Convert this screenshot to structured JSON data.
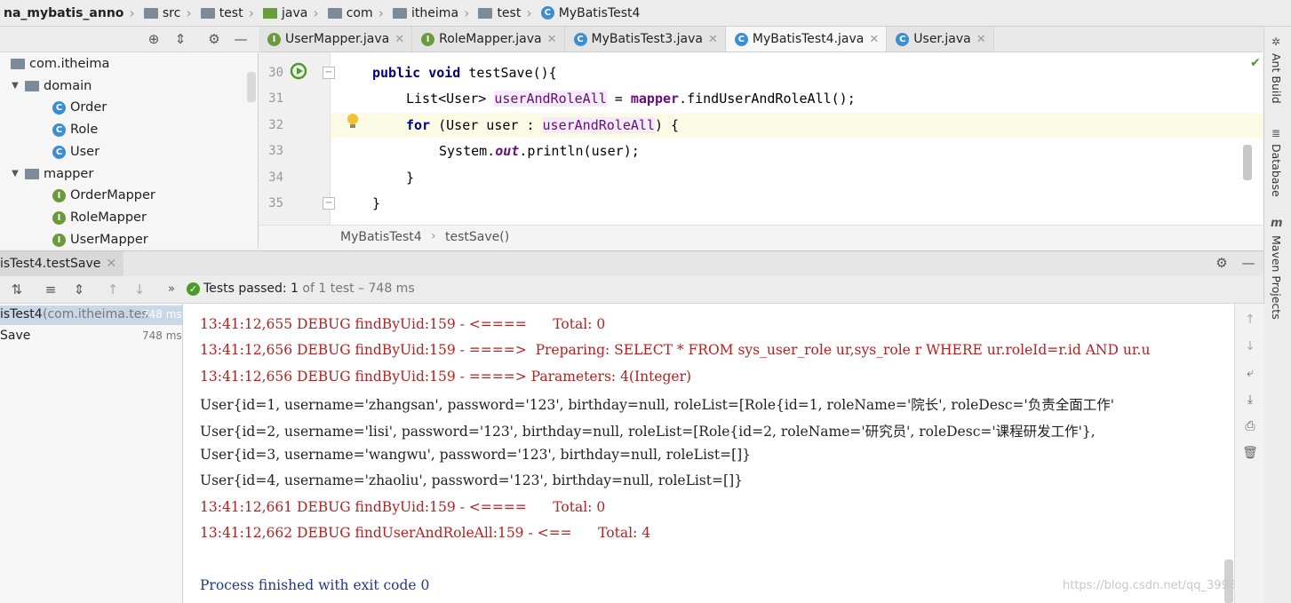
{
  "breadcrumb": [
    "na_mybatis_anno",
    "src",
    "test",
    "java",
    "com",
    "itheima",
    "test",
    "MyBatisTest4"
  ],
  "project_tree": [
    {
      "label": "com.itheima",
      "icon": "package-icon",
      "indent": 0
    },
    {
      "label": "domain",
      "icon": "package-icon",
      "indent": 1,
      "expanded": true
    },
    {
      "label": "Order",
      "icon": "class-icon",
      "indent": 2
    },
    {
      "label": "Role",
      "icon": "class-icon",
      "indent": 2
    },
    {
      "label": "User",
      "icon": "class-icon",
      "indent": 2
    },
    {
      "label": "mapper",
      "icon": "package-icon",
      "indent": 1,
      "expanded": true
    },
    {
      "label": "OrderMapper",
      "icon": "interface-icon",
      "indent": 2
    },
    {
      "label": "RoleMapper",
      "icon": "interface-icon",
      "indent": 2
    },
    {
      "label": "UserMapper",
      "icon": "interface-icon",
      "indent": 2
    }
  ],
  "tabs": [
    {
      "label": "UserMapper.java",
      "icon": "interface-icon",
      "active": false
    },
    {
      "label": "RoleMapper.java",
      "icon": "interface-icon",
      "active": false
    },
    {
      "label": "MyBatisTest3.java",
      "icon": "class-icon",
      "active": false
    },
    {
      "label": "MyBatisTest4.java",
      "icon": "class-icon",
      "active": true
    },
    {
      "label": "User.java",
      "icon": "class-icon",
      "active": false
    }
  ],
  "code": {
    "line_numbers": [
      "30",
      "31",
      "32",
      "33",
      "34",
      "35"
    ],
    "l30_kw": "public void",
    "l30_rest": " testSave(){",
    "l31_a": "List<User> ",
    "l31_var": "userAndRoleAll",
    "l31_b": " = ",
    "l31_mapper": "mapper",
    "l31_c": ".findUserAndRoleAll();",
    "l32_kw": "for",
    "l32_a": " (User user : ",
    "l32_var": "userAndRoleAll",
    "l32_b": ") {",
    "l33_a": "System.",
    "l33_out": "out",
    "l33_b": ".println(user);",
    "l34": "}",
    "l35": "}"
  },
  "editor_breadcrumb": [
    "MyBatisTest4",
    "testSave()"
  ],
  "run": {
    "tab_label": "isTest4.testSave",
    "status_label": "Tests passed:",
    "passed": "1",
    "of_text": "of 1 test – 748 ms",
    "tests": [
      {
        "name": "isTest4",
        "detail": "(com.itheima.tes",
        "time": "748 ms"
      },
      {
        "name": "Save",
        "detail": "",
        "time": "748 ms"
      }
    ]
  },
  "console": [
    {
      "kind": "dbg",
      "text": "13:41:12,655 DEBUG findByUid:159 - <====      Total: 0"
    },
    {
      "kind": "dbg",
      "text": "13:41:12,656 DEBUG findByUid:159 - ====>  Preparing: SELECT * FROM sys_user_role ur,sys_role r WHERE ur.roleId=r.id AND ur.u"
    },
    {
      "kind": "dbg",
      "text": "13:41:12,656 DEBUG findByUid:159 - ====> Parameters: 4(Integer)"
    },
    {
      "kind": "out",
      "text": "User{id=1, username='zhangsan', password='123', birthday=null, roleList=[Role{id=1, roleName='院长', roleDesc='负责全面工作'"
    },
    {
      "kind": "out",
      "text": "User{id=2, username='lisi', password='123', birthday=null, roleList=[Role{id=2, roleName='研究员', roleDesc='课程研发工作'},"
    },
    {
      "kind": "out",
      "text": "User{id=3, username='wangwu', password='123', birthday=null, roleList=[]}"
    },
    {
      "kind": "out",
      "text": "User{id=4, username='zhaoliu', password='123', birthday=null, roleList=[]}"
    },
    {
      "kind": "dbg",
      "text": "13:41:12,661 DEBUG findByUid:159 - <====      Total: 0"
    },
    {
      "kind": "dbg",
      "text": "13:41:12,662 DEBUG findUserAndRoleAll:159 - <==      Total: 4"
    },
    {
      "kind": "blank",
      "text": ""
    },
    {
      "kind": "proc",
      "text": "Process finished with exit code 0"
    }
  ],
  "watermark": "https://blog.csdn.net/qq_39965800",
  "right_strip": [
    "Ant Build",
    "Database",
    "Maven Projects"
  ]
}
